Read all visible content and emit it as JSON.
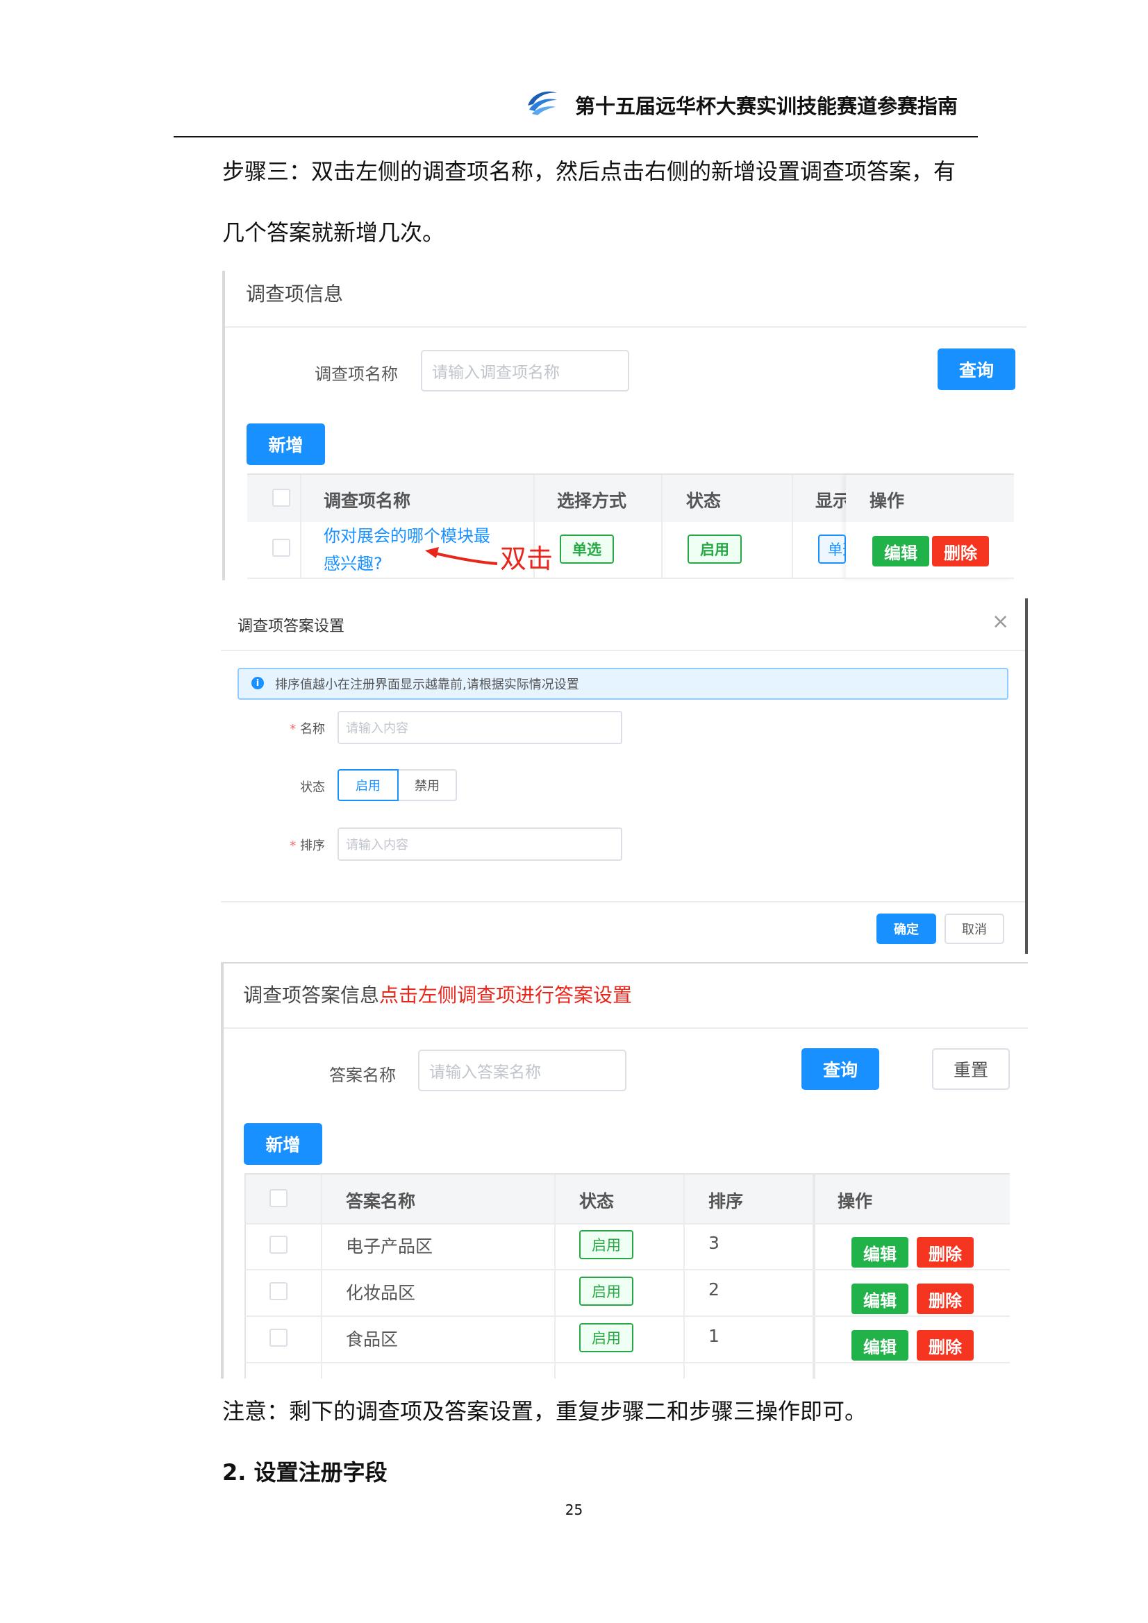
{
  "header": {
    "title": "第十五届远华杯大赛实训技能赛道参赛指南"
  },
  "step_text": {
    "line1": "步骤三：双击左侧的调查项名称，然后点击右侧的新增设置调查项答案，有",
    "line2": "几个答案就新增几次。"
  },
  "survey_panel": {
    "title": "调查项信息",
    "search_label": "调查项名称",
    "search_placeholder": "请输入调查项名称",
    "query_label": "查询",
    "add_label": "新增",
    "columns": [
      "调查项名称",
      "选择方式",
      "状态",
      "显示",
      "操作"
    ],
    "row": {
      "name_line1": "你对展会的哪个模块最",
      "name_line2": "感兴趣?",
      "mode": "单选",
      "status": "启用",
      "display": "单选",
      "edit": "编辑",
      "delete": "删除"
    },
    "annotation": "双击",
    "colors": {
      "accent": "#1890ff",
      "annotation": "#e8261b"
    }
  },
  "modal": {
    "title": "调查项答案设置",
    "info": "排序值越小在注册界面显示越靠前,请根据实际情况设置",
    "name_label": "名称",
    "name_placeholder": "请输入内容",
    "status_label": "状态",
    "status_on": "启用",
    "status_off": "禁用",
    "order_label": "排序",
    "order_placeholder": "请输入内容",
    "confirm": "确定",
    "cancel": "取消",
    "required_mark": "*"
  },
  "answer_panel": {
    "title": "调查项答案信息",
    "title_hint": "点击左侧调查项进行答案设置",
    "search_label": "答案名称",
    "search_placeholder": "请输入答案名称",
    "query_label": "查询",
    "reset_label": "重置",
    "add_label": "新增",
    "columns": [
      "答案名称",
      "状态",
      "排序",
      "操作"
    ],
    "rows": [
      {
        "name": "电子产品区",
        "status": "启用",
        "order": "3",
        "edit": "编辑",
        "delete": "删除"
      },
      {
        "name": "化妆品区",
        "status": "启用",
        "order": "2",
        "edit": "编辑",
        "delete": "删除"
      },
      {
        "name": "食品区",
        "status": "启用",
        "order": "1",
        "edit": "编辑",
        "delete": "删除"
      }
    ]
  },
  "note_text": "注意：剩下的调查项及答案设置，重复步骤二和步骤三操作即可。",
  "section_heading": "2. 设置注册字段",
  "page_number": "25"
}
